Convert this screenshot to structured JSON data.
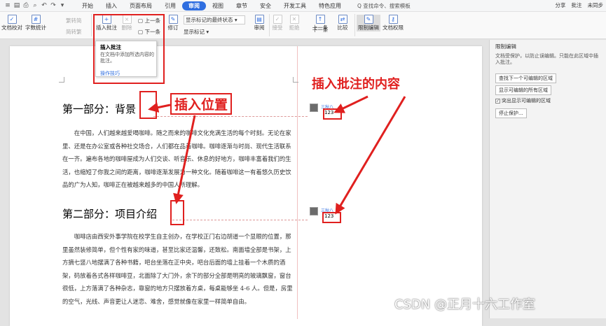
{
  "menubar": {
    "quick_icons": [
      "≡",
      "▤",
      "⎙",
      "⌕",
      "↶",
      "↷",
      "▾"
    ],
    "tabs": [
      "开始",
      "插入",
      "页面布局",
      "引用",
      "审阅",
      "视图",
      "章节",
      "安全",
      "开发工具",
      "特色应用"
    ],
    "active_tab": "审阅",
    "search": "Q 查找命令、搜索模板",
    "right": [
      "分享",
      "批注",
      "未同步"
    ]
  },
  "ribbon": {
    "doc_proof": "文档校对",
    "word_count": "字数统计",
    "simp_trad": "繁转简",
    "trad_simp": "简转繁",
    "insert_comment": "插入批注",
    "delete": "删除",
    "prev": "上一条",
    "next": "下一条",
    "display_mode": "显示标记的最终状态",
    "show_marks": "显示标记",
    "track_changes": "修订",
    "review": "审阅",
    "accept": "接受",
    "reject": "拒绝",
    "prev2": "上一条",
    "next2": "下一条",
    "compare": "比较",
    "restrict_edit": "限制编辑",
    "doc_permission": "文档权限"
  },
  "popup": {
    "title": "插入批注",
    "desc": "在文档中添加所选内容的批注。",
    "link": "操作技巧"
  },
  "doc": {
    "heading1": "第一部分：背景",
    "para1": "在中国，人们越来越爱喝咖啡。随之而来的咖啡文化充满生活的每个时刻。无论在家里、还是在办公室或各种社交场合，人们都在品着咖啡。咖啡逐渐与时尚、现代生活联系在一齐。遍布各地的咖啡屋成为人们交谈、听音乐、休息的好地方，咖啡丰富着我们的生活，也缩短了你我之间的距离，咖啡逐渐发展为一种文化。随着咖啡这一有着悠久历史饮品的广为人知，咖啡正在被越来越多的中国人所理解。",
    "heading2": "第二部分：项目介绍",
    "para2": "咖啡店由西安外事学院在校学生自主创办，在学校正门右边胡道一个显眼的位置，那里虽然装修简单，但个性有家的味道，甚至比家还温馨，还致松。南面墙全部是书架，上方摘七竖八地摆满了各种书籍，吧台坐落在正中央，吧台后面的墙上挂着一个木质的酒架，码放着各式各样咖啡豆，北面除了大门外，余下的部分全部是明亮的玻璃飘窗，窗台很低，上方落满了各种杂志，靠窗的地方只摆放着方桌，每桌能够坐 4-6 人。但是，房里的空气，光线、声音更让人迷恋、难舍，感觉就像在家里一样简单自由。"
  },
  "comments": [
    {
      "author": "三秋八",
      "text": "123"
    },
    {
      "author": "三秋八",
      "text": "123"
    }
  ],
  "panel": {
    "title": "限制编辑",
    "desc": "文档受保护，以防止误编辑。只能在此区域中插入批注。",
    "btn_find": "查找下一个可编辑的区域",
    "btn_show_all": "显示可编辑的所有区域",
    "check_highlight": "突出显示可编辑的区域",
    "btn_stop": "停止保护..."
  },
  "annotations": {
    "insert_position": "插入位置",
    "insert_content": "插入批注的内容"
  },
  "watermark": "CSDN @正月十六工作室"
}
